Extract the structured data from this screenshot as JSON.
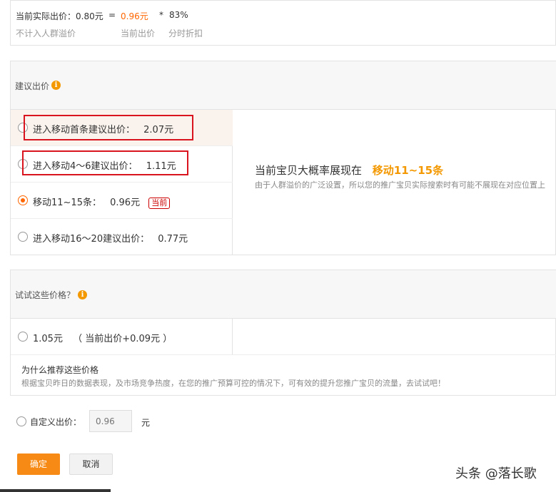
{
  "formula": {
    "actual_bid": "当前实际出价：0.80元",
    "equals": "=",
    "current_bid_value": "0.96元",
    "times": "*",
    "discount_value": "83%",
    "label_actual": "不计入人群溢价",
    "label_current": "当前出价",
    "label_discount": "分时折扣"
  },
  "suggest": {
    "title": "建议出价",
    "options": [
      {
        "label": "进入移动首条建议出价：",
        "value": "2.07元"
      },
      {
        "label": "进入移动4～6建议出价：",
        "value": "1.11元"
      },
      {
        "label": "移动11~15条：",
        "value": "0.96元",
        "badge": "当前"
      },
      {
        "label": "进入移动16～20建议出价：",
        "value": "0.77元"
      }
    ],
    "display_prefix": "当前宝贝大概率展现在",
    "display_position": "移动11~15条",
    "display_note": "由于人群溢价的广泛设置，所以您的推广宝贝实际搜索时有可能不展现在对应位置上"
  },
  "try": {
    "title": "试试这些价格？",
    "option_value": "1.05元",
    "option_note": "（ 当前出价+0.09元 ）",
    "why_title": "为什么推荐这些价格",
    "why_text": "根据宝贝昨日的数据表现，及市场竞争热度，在您的推广预算可控的情况下，可有效的提升您推广宝贝的流量，去试试吧！"
  },
  "custom": {
    "label": "自定义出价：",
    "placeholder": "0.96",
    "unit": "元"
  },
  "buttons": {
    "confirm": "确定",
    "cancel": "取消"
  },
  "watermark": "头条 @落长歌",
  "colors": {
    "accent": "#f60",
    "highlight_border": "#d9141e",
    "info_icon": "#f39800"
  }
}
